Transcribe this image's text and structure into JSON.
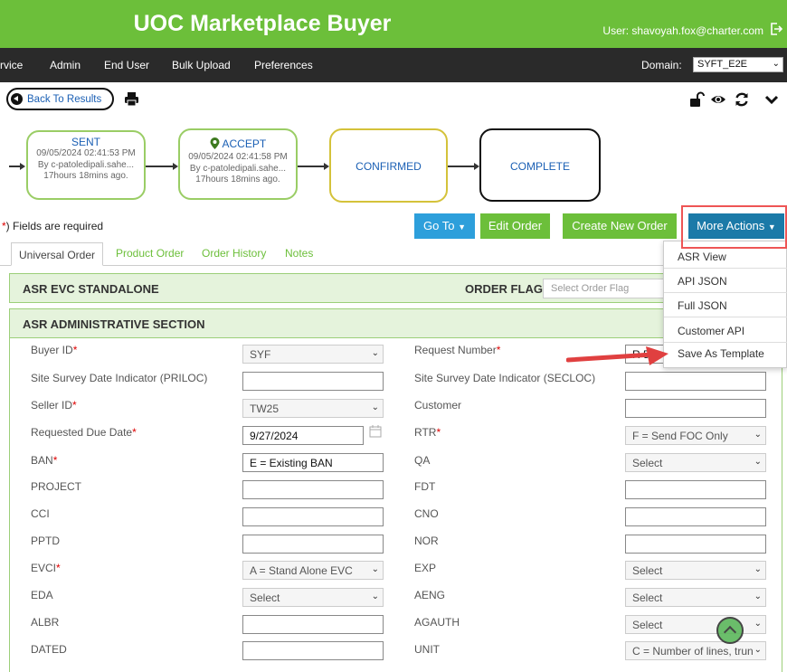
{
  "header": {
    "title": "UOC Marketplace Buyer",
    "user": "User: shavoyah.fox@charter.com"
  },
  "nav": {
    "items": [
      "rvice",
      "Admin",
      "End User",
      "Bulk Upload",
      "Preferences"
    ],
    "domain_label": "Domain:",
    "domain_value": "SYFT_E2E"
  },
  "toolbar": {
    "back_label": "Back To Results",
    "icons": [
      "print-icon",
      "unlock-icon",
      "eye-icon",
      "refresh-icon",
      "chevron-down-icon"
    ]
  },
  "workflow": [
    {
      "status": "SENT",
      "date": "09/05/2024 02:41:53 PM",
      "by": "By c-patoledipali.sahe...",
      "ago": "17hours 18mins ago."
    },
    {
      "status": "ACCEPT",
      "date": "09/05/2024 02:41:58 PM",
      "by": "By c-patoledipali.sahe...",
      "ago": "17hours 18mins ago."
    },
    {
      "status": "CONFIRMED"
    },
    {
      "status": "COMPLETE"
    }
  ],
  "required_note": {
    "star": "*",
    "text": "Fields are required"
  },
  "buttons": {
    "goto": "Go To",
    "edit": "Edit Order",
    "create": "Create New Order",
    "more": "More Actions"
  },
  "tabs": [
    "Universal Order",
    "Product Order",
    "Order History",
    "Notes"
  ],
  "section1": {
    "title": "ASR EVC STANDALONE",
    "flag_label": "ORDER FLAG",
    "flag_placeholder": "Select Order Flag"
  },
  "section2": {
    "title": "ASR ADMINISTRATIVE SECTION"
  },
  "form_left": [
    {
      "label": "Buyer ID",
      "req": "*",
      "value": "SYF",
      "select": true
    },
    {
      "label": "Site Survey Date Indicator (PRILOC)",
      "req": "",
      "value": ""
    },
    {
      "label": "Seller ID",
      "req": "*",
      "value": "TW25",
      "select": true
    },
    {
      "label": "Requested Due Date",
      "req": "*",
      "value": "9/27/2024"
    },
    {
      "label": "BAN",
      "req": "*",
      "value": "E = Existing BAN"
    },
    {
      "label": "PROJECT",
      "req": "",
      "value": ""
    },
    {
      "label": "CCI",
      "req": "",
      "value": ""
    },
    {
      "label": "PPTD",
      "req": "",
      "value": ""
    },
    {
      "label": "EVCI",
      "req": "*",
      "value": "A = Stand Alone EVC",
      "select": true
    },
    {
      "label": "EDA",
      "req": "",
      "value": "Select",
      "select": true
    },
    {
      "label": "ALBR",
      "req": "",
      "value": ""
    },
    {
      "label": "DATED",
      "req": "",
      "value": ""
    }
  ],
  "form_right": [
    {
      "label": "Request Number",
      "req": "*",
      "value": "R 50"
    },
    {
      "label": "Site Survey Date Indicator (SECLOC)",
      "req": "",
      "value": ""
    },
    {
      "label": "Customer",
      "req": "",
      "value": ""
    },
    {
      "label": "RTR",
      "req": "*",
      "value": "F = Send FOC Only",
      "select": true
    },
    {
      "label": "QA",
      "req": "",
      "value": "Select",
      "select": true
    },
    {
      "label": "FDT",
      "req": "",
      "value": ""
    },
    {
      "label": "CNO",
      "req": "",
      "value": ""
    },
    {
      "label": "NOR",
      "req": "",
      "value": ""
    },
    {
      "label": "EXP",
      "req": "",
      "value": "Select",
      "select": true
    },
    {
      "label": "AENG",
      "req": "",
      "value": "Select",
      "select": true
    },
    {
      "label": "AGAUTH",
      "req": "",
      "value": "Select",
      "select": true
    },
    {
      "label": "UNIT",
      "req": "",
      "value": "C = Number of lines, trun",
      "select": true
    }
  ],
  "more_menu": [
    "ASR View",
    "API JSON",
    "Full JSON",
    "Customer API",
    "Save As Template"
  ],
  "colors": {
    "green": "#6cbf3a",
    "blue": "#2d9fdb",
    "teal": "#1b7aa8",
    "dark": "#2a2a2a",
    "highlight": "#e55555"
  }
}
